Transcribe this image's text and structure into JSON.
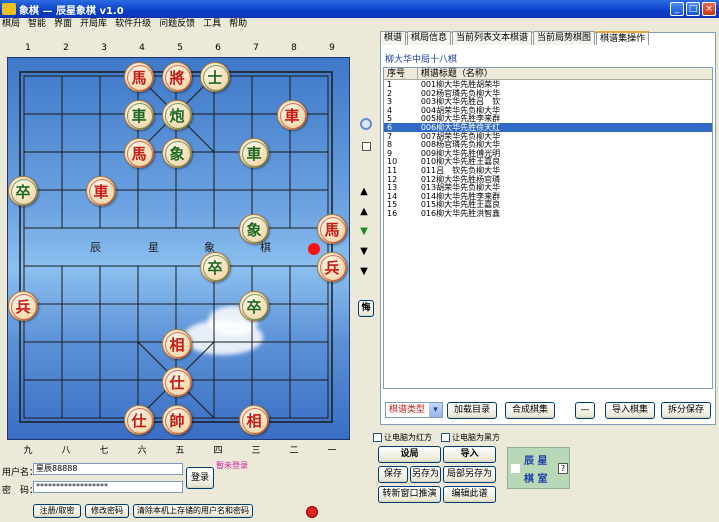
{
  "window": {
    "title": "象棋 — 辰星象棋 v1.0",
    "buttons": [
      "_",
      "□",
      "×"
    ]
  },
  "menu": [
    "棋局",
    "智能",
    "界面",
    "开局库",
    "软件升级",
    "问题反馈",
    "工具",
    "帮助"
  ],
  "board": {
    "top_numbers": [
      "1",
      "2",
      "3",
      "4",
      "5",
      "6",
      "7",
      "8",
      "9"
    ],
    "bottom_numbers": [
      "九",
      "八",
      "七",
      "六",
      "五",
      "四",
      "三",
      "二",
      "一"
    ],
    "river_text": [
      "辰",
      "星",
      "象",
      "棋"
    ]
  },
  "pieces": [
    {
      "char": "馬",
      "side": "red"
    },
    {
      "char": "將",
      "side": "red"
    },
    {
      "char": "士",
      "side": "green"
    },
    {
      "char": "車",
      "side": "green"
    },
    {
      "char": "炮",
      "side": "green"
    },
    {
      "char": "車",
      "side": "red"
    },
    {
      "char": "馬",
      "side": "red"
    },
    {
      "char": "象",
      "side": "green"
    },
    {
      "char": "車",
      "side": "green"
    },
    {
      "char": "卒",
      "side": "green"
    },
    {
      "char": "車",
      "side": "red"
    },
    {
      "char": "象",
      "side": "green"
    },
    {
      "char": "馬",
      "side": "red"
    },
    {
      "char": "卒",
      "side": "green"
    },
    {
      "char": "兵",
      "side": "red"
    },
    {
      "char": "兵",
      "side": "red"
    },
    {
      "char": "卒",
      "side": "green"
    },
    {
      "char": "相",
      "side": "red"
    },
    {
      "char": "仕",
      "side": "red"
    },
    {
      "char": "仕",
      "side": "red"
    },
    {
      "char": "帥",
      "side": "red"
    },
    {
      "char": "相",
      "side": "red"
    }
  ],
  "side_nav": [
    "▲",
    "▲",
    "▼",
    "▼",
    "▼"
  ],
  "side_nav_colors": [
    "#000",
    "#000",
    "#1a8a1a",
    "#000",
    "#000"
  ],
  "side_button": "悔",
  "tabs": [
    "棋谱",
    "棋局信息",
    "当前列表文本棋谱",
    "当前局势棋图",
    "棋谱集操作"
  ],
  "game_title": "柳大华中局十八棋",
  "list_headers": [
    "序号",
    "棋谱标题（名称）"
  ],
  "list_rows": [
    {
      "n": "1",
      "t": "001柳大华先胜胡荣华"
    },
    {
      "n": "2",
      "t": "002杨官璘先负柳大华"
    },
    {
      "n": "3",
      "t": "003柳大华先胜吕　钦"
    },
    {
      "n": "4",
      "t": "004胡荣华先负柳大华"
    },
    {
      "n": "5",
      "t": "005柳大华先胜李来群"
    },
    {
      "n": "6",
      "t": "006柳大华先胜徐天红",
      "selected": true
    },
    {
      "n": "7",
      "t": "007胡荣华先负柳大华"
    },
    {
      "n": "8",
      "t": "008杨官璘先负柳大华"
    },
    {
      "n": "9",
      "t": "009柳大华先胜傅光明"
    },
    {
      "n": "10",
      "t": "010柳大华先胜王嘉良"
    },
    {
      "n": "11",
      "t": "011吕　钦先负柳大华"
    },
    {
      "n": "12",
      "t": "012柳大华先胜杨官璘"
    },
    {
      "n": "13",
      "t": "013胡荣华先负柳大华"
    },
    {
      "n": "14",
      "t": "014柳大华先胜李来群"
    },
    {
      "n": "15",
      "t": "015柳大华先胜王嘉良"
    },
    {
      "n": "16",
      "t": "016柳大华先胜洪智鑫"
    }
  ],
  "panel_buttons": {
    "type_select": "棋谱类型",
    "load_dir": "加载目录",
    "collection": "合成棋集",
    "minus": "—",
    "import": "导入棋集",
    "split_save": "拆分保存"
  },
  "checks": {
    "red_ai": "让电脑为红方",
    "black_ai": "让电脑为黑方"
  },
  "actions": {
    "save_game": "设局",
    "import": "导入",
    "save": "保存",
    "save_as": "另存为",
    "local_save_as": "局部另存为",
    "new_window": "转新窗口推演",
    "edit": "编辑此谱"
  },
  "brand": {
    "line1": "辰 星",
    "line2": "棋 室",
    "help": "?"
  },
  "login": {
    "user_label": "用户名：",
    "user_value": "星辰88888",
    "pwd_label": "密　码：",
    "pwd_value": "******************",
    "login_btn": "登录",
    "logged_text": "暂未登录",
    "register": "注册/取密",
    "change_pwd": "修改密码",
    "clear_stored": "清除本机上存储的用户名和密码"
  }
}
